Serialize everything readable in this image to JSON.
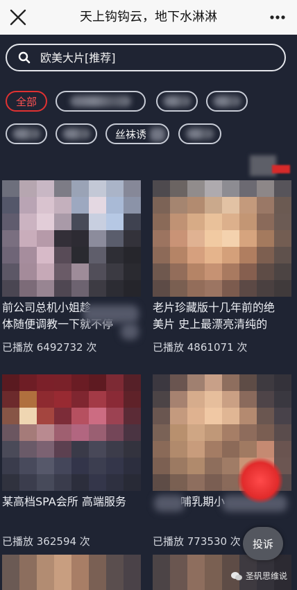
{
  "header": {
    "title": "天上钩钩云，地下水淋淋"
  },
  "search": {
    "placeholder": "欧美大片[推荐]"
  },
  "categories": {
    "all_label": "全部",
    "partial_label": "丝袜诱"
  },
  "videos": [
    {
      "title": "前公司总机小姐趁",
      "title_line2": "体随便调教一下就不停",
      "plays": "已播放 6492732 次"
    },
    {
      "title": "老片珍藏版十几年前的绝",
      "title_line2": "美片 史上最漂亮清纯的",
      "plays": "已播放 4861071 次"
    },
    {
      "title": "某高档SPA会所 高端服务",
      "title_line2": "",
      "plays": "已播放 362594 次"
    },
    {
      "title": "哺乳期小",
      "title_line2": "",
      "plays": "已播放 773530 次"
    }
  ],
  "report_label": "投诉",
  "watermark": "圣矾思维说",
  "colors": {
    "background": "#1f2433",
    "accent_red": "#e13232",
    "topbar": "#f7f7f7"
  }
}
